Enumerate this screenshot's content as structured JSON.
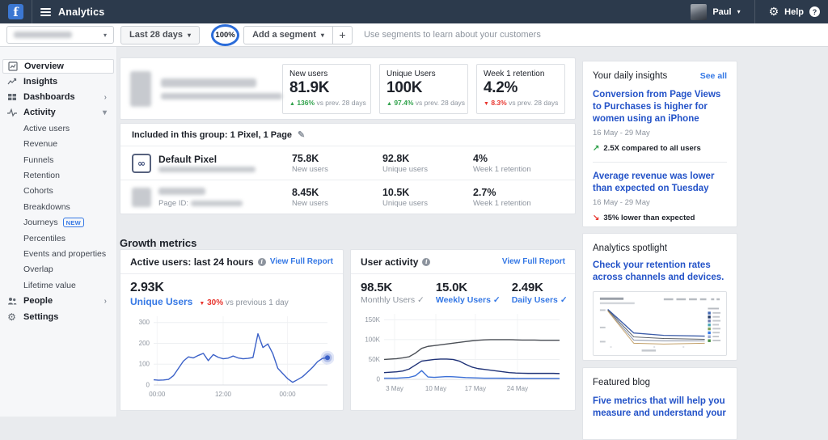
{
  "colors": {
    "nav_bg": "#2c3a4c",
    "fb_blue": "#3b77d2",
    "accent_blue": "#3578e5",
    "headline_blue": "#2453c8",
    "green": "#31a24c",
    "red": "#e8352e",
    "chart_blue": "#3b61c8",
    "weekly_blue": "#1f3277",
    "monthly_gray": "#4b4f56",
    "zoom_ring_blue": "#2b6cd9"
  },
  "topnav": {
    "app_title": "Analytics",
    "user_name": "Paul",
    "help_label": "Help"
  },
  "toolbar": {
    "date_range_label": "Last 28 days",
    "zoom_value": "100%",
    "add_segment_label": "Add a segment",
    "plus_label": "+",
    "hint_text": "Use segments to learn about your customers"
  },
  "sidebar": {
    "items": [
      {
        "label": "Overview"
      },
      {
        "label": "Insights"
      },
      {
        "label": "Dashboards"
      },
      {
        "label": "Activity"
      },
      {
        "label": "Active users"
      },
      {
        "label": "Revenue"
      },
      {
        "label": "Funnels"
      },
      {
        "label": "Retention"
      },
      {
        "label": "Cohorts"
      },
      {
        "label": "Breakdowns"
      },
      {
        "label": "Journeys",
        "badge": "NEW"
      },
      {
        "label": "Percentiles"
      },
      {
        "label": "Events and properties"
      },
      {
        "label": "Overlap"
      },
      {
        "label": "Lifetime value"
      },
      {
        "label": "People"
      },
      {
        "label": "Settings"
      }
    ]
  },
  "overview": {
    "stats": [
      {
        "label": "New users",
        "value": "81.9K",
        "delta": "136%",
        "delta_dir": "up",
        "delta_suffix": "vs prev. 28 days"
      },
      {
        "label": "Unique Users",
        "value": "100K",
        "delta": "97.4%",
        "delta_dir": "up",
        "delta_suffix": "vs prev. 28 days"
      },
      {
        "label": "Week 1 retention",
        "value": "4.2%",
        "delta": "8.3%",
        "delta_dir": "down",
        "delta_suffix": "vs prev. 28 days"
      }
    ],
    "group_note": "Included in this group: 1 Pixel, 1 Page",
    "rows": [
      {
        "name": "Default Pixel",
        "metrics": [
          {
            "value": "75.8K",
            "label": "New users"
          },
          {
            "value": "92.8K",
            "label": "Unique users"
          },
          {
            "value": "4%",
            "label": "Week 1 retention"
          }
        ]
      },
      {
        "name": "",
        "page_id_label": "Page ID:",
        "metrics": [
          {
            "value": "8.45K",
            "label": "New users"
          },
          {
            "value": "10.5K",
            "label": "Unique users"
          },
          {
            "value": "2.7%",
            "label": "Week 1 retention"
          }
        ]
      }
    ]
  },
  "growth": {
    "section_title": "Growth metrics",
    "left": {
      "title": "Active users: last 24 hours",
      "link": "View Full Report",
      "value": "2.93K",
      "value_label": "Unique Users",
      "delta": "30%",
      "delta_suffix": "vs previous 1 day"
    },
    "right": {
      "title": "User activity",
      "link": "View Full Report",
      "stats": [
        {
          "value": "98.5K",
          "label": "Monthly Users",
          "check": "✓"
        },
        {
          "value": "15.0K",
          "label": "Weekly Users",
          "check": "✓"
        },
        {
          "value": "2.49K",
          "label": "Daily Users",
          "check": "✓"
        }
      ]
    }
  },
  "insights": {
    "title": "Your daily insights",
    "see_all": "See all",
    "items": [
      {
        "headline": "Conversion from Page Views to Purchases is higher for women using an iPhone",
        "date_range": "16 May - 29 May",
        "delta": "2.5X compared to all users",
        "dir": "up"
      },
      {
        "headline": "Average revenue was lower than expected on Tuesday",
        "date_range": "16 May - 29 May",
        "delta": "35% lower than expected",
        "dir": "down"
      }
    ]
  },
  "spotlight": {
    "title": "Analytics spotlight",
    "headline": "Check your retention rates across channels and devices."
  },
  "blog": {
    "title": "Featured blog",
    "headline": "Five metrics that will help you measure and understand your"
  },
  "chart_data": [
    {
      "type": "line",
      "title": "Active users: last 24 hours",
      "xlabel": "",
      "ylabel": "",
      "ylim": [
        0,
        330
      ],
      "grid": true,
      "legend_position": "none",
      "y_ticks": [
        {
          "v": 0,
          "label": "0"
        },
        {
          "v": 100,
          "label": "100"
        },
        {
          "v": 200,
          "label": "200"
        },
        {
          "v": 300,
          "label": "300"
        }
      ],
      "x_ticks": [
        {
          "pos": 0.02,
          "label": "00:00"
        },
        {
          "pos": 0.4,
          "label": "12:00"
        },
        {
          "pos": 0.77,
          "label": "00:00"
        }
      ],
      "series": [
        {
          "name": "Unique Users",
          "color": "#3b61c8",
          "end_marker": true,
          "values": [
            25,
            23,
            24,
            27,
            45,
            80,
            115,
            135,
            130,
            142,
            152,
            117,
            146,
            133,
            126,
            129,
            139,
            130,
            126,
            128,
            132,
            246,
            180,
            197,
            150,
            80,
            55,
            30,
            13,
            26,
            40,
            62,
            85,
            112,
            128,
            131
          ]
        }
      ]
    },
    {
      "type": "line",
      "title": "User activity",
      "xlabel": "",
      "ylabel": "",
      "ylim": [
        0,
        165
      ],
      "grid": true,
      "legend_position": "none",
      "y_ticks": [
        {
          "v": 0,
          "label": "0"
        },
        {
          "v": 50,
          "label": "50K"
        },
        {
          "v": 100,
          "label": "100K"
        },
        {
          "v": 150,
          "label": "150K"
        }
      ],
      "x_ticks": [
        {
          "pos": 0.06,
          "label": "3 May"
        },
        {
          "pos": 0.295,
          "label": "10 May"
        },
        {
          "pos": 0.52,
          "label": "17 May"
        },
        {
          "pos": 0.76,
          "label": "24 May"
        }
      ],
      "series": [
        {
          "name": "Monthly Users",
          "color": "#4b4f56",
          "values": [
            50,
            51,
            52,
            54,
            57,
            66,
            78,
            83,
            85,
            87,
            89,
            91,
            93,
            95,
            97,
            98.5,
            99.5,
            100,
            100,
            100,
            100,
            99.5,
            99,
            99,
            99,
            98.5,
            98.5,
            98.5,
            98.5
          ]
        },
        {
          "name": "Weekly Users",
          "color": "#1f3277",
          "values": [
            17,
            18,
            19,
            21,
            26,
            36,
            46,
            48,
            50,
            51,
            51,
            50,
            46,
            38,
            31,
            27,
            25,
            23,
            21,
            19,
            17,
            16,
            15.5,
            15,
            15,
            15,
            15,
            15,
            14.5
          ]
        },
        {
          "name": "Daily Users",
          "color": "#3b6fd6",
          "values": [
            3,
            3,
            3,
            4,
            5,
            9,
            22,
            6,
            5,
            6,
            7,
            6.5,
            5.5,
            4.5,
            4,
            3.5,
            3,
            3,
            3,
            2.8,
            2.6,
            2.5,
            2.5,
            2.5,
            2.5,
            2.5,
            2.5,
            2.5,
            2.5
          ]
        }
      ]
    }
  ]
}
